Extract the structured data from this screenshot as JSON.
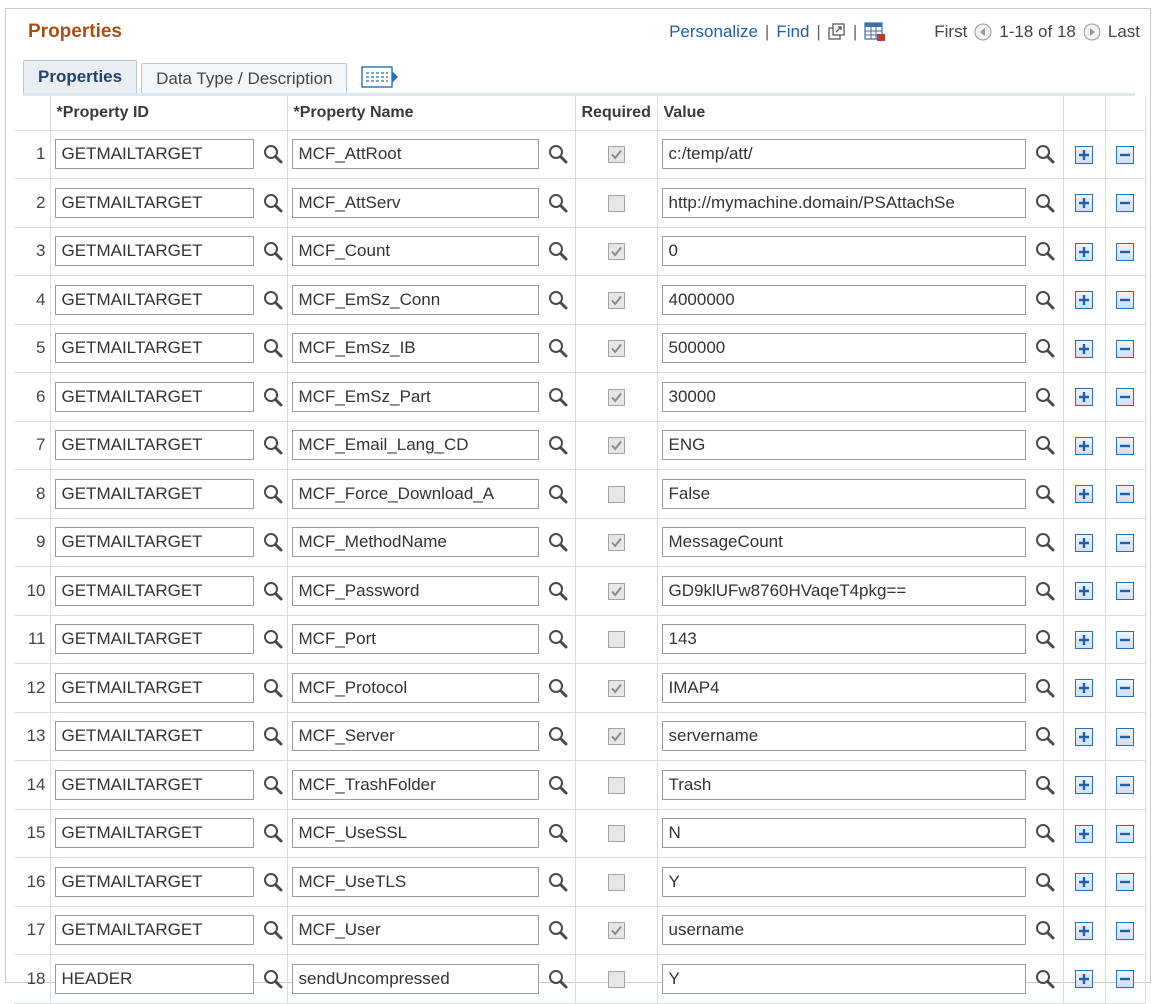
{
  "header": {
    "title": "Properties",
    "personalize": "Personalize",
    "find": "Find",
    "sep": "|",
    "first": "First",
    "range": "1-18 of 18",
    "last": "Last"
  },
  "tabs": [
    {
      "label": "Properties",
      "active": true
    },
    {
      "label": "Data Type / Description",
      "active": false
    }
  ],
  "columns": {
    "property_id": "*Property ID",
    "property_name": "*Property Name",
    "required": "Required",
    "value": "Value"
  },
  "rows": [
    {
      "num": "1",
      "id": "GETMAILTARGET",
      "name": "MCF_AttRoot",
      "required": true,
      "value": "c:/temp/att/"
    },
    {
      "num": "2",
      "id": "GETMAILTARGET",
      "name": "MCF_AttServ",
      "required": false,
      "value": "http://mymachine.domain/PSAttachSe"
    },
    {
      "num": "3",
      "id": "GETMAILTARGET",
      "name": "MCF_Count",
      "required": true,
      "value": "0"
    },
    {
      "num": "4",
      "id": "GETMAILTARGET",
      "name": "MCF_EmSz_Conn",
      "required": true,
      "value": "4000000"
    },
    {
      "num": "5",
      "id": "GETMAILTARGET",
      "name": "MCF_EmSz_IB",
      "required": true,
      "value": "500000"
    },
    {
      "num": "6",
      "id": "GETMAILTARGET",
      "name": "MCF_EmSz_Part",
      "required": true,
      "value": "30000"
    },
    {
      "num": "7",
      "id": "GETMAILTARGET",
      "name": "MCF_Email_Lang_CD",
      "required": true,
      "value": "ENG"
    },
    {
      "num": "8",
      "id": "GETMAILTARGET",
      "name": "MCF_Force_Download_A",
      "required": false,
      "value": "False"
    },
    {
      "num": "9",
      "id": "GETMAILTARGET",
      "name": "MCF_MethodName",
      "required": true,
      "value": "MessageCount"
    },
    {
      "num": "10",
      "id": "GETMAILTARGET",
      "name": "MCF_Password",
      "required": true,
      "value": "GD9klUFw8760HVaqeT4pkg=="
    },
    {
      "num": "11",
      "id": "GETMAILTARGET",
      "name": "MCF_Port",
      "required": false,
      "value": "143"
    },
    {
      "num": "12",
      "id": "GETMAILTARGET",
      "name": "MCF_Protocol",
      "required": true,
      "value": "IMAP4"
    },
    {
      "num": "13",
      "id": "GETMAILTARGET",
      "name": "MCF_Server",
      "required": true,
      "value": "servername"
    },
    {
      "num": "14",
      "id": "GETMAILTARGET",
      "name": "MCF_TrashFolder",
      "required": false,
      "value": "Trash"
    },
    {
      "num": "15",
      "id": "GETMAILTARGET",
      "name": "MCF_UseSSL",
      "required": false,
      "value": "N"
    },
    {
      "num": "16",
      "id": "GETMAILTARGET",
      "name": "MCF_UseTLS",
      "required": false,
      "value": "Y"
    },
    {
      "num": "17",
      "id": "GETMAILTARGET",
      "name": "MCF_User",
      "required": true,
      "value": "username"
    },
    {
      "num": "18",
      "id": "HEADER",
      "name": "sendUncompressed",
      "required": false,
      "value": "Y"
    }
  ],
  "icons": {
    "lookup": "magnifier-icon",
    "add": "plus-icon",
    "delete": "minus-icon",
    "popup": "new-window-icon",
    "download": "download-grid-icon",
    "prev": "previous-arrow-icon",
    "next": "next-arrow-icon",
    "expand": "show-all-columns-icon"
  },
  "colors": {
    "title": "#a84f16",
    "link": "#1f5ea8",
    "button_border": "#2e6fb0"
  }
}
